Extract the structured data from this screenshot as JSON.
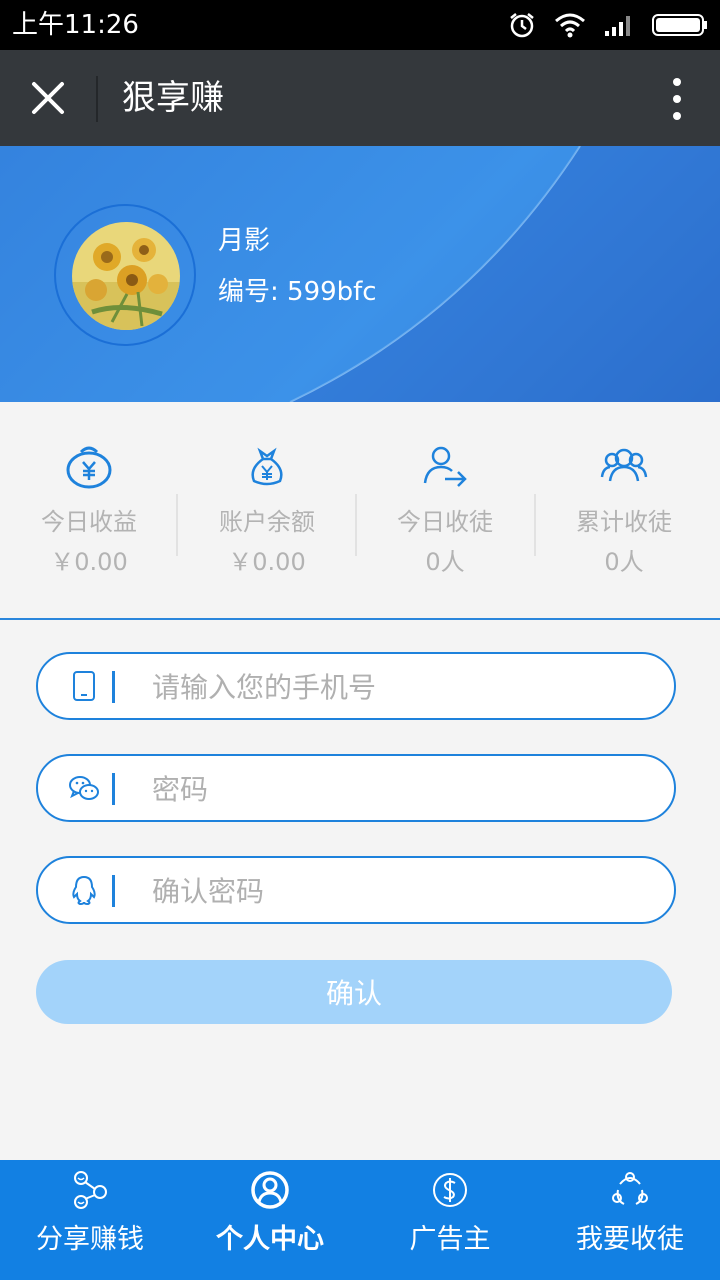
{
  "status_bar": {
    "time": "上午11:26"
  },
  "header": {
    "title": "狠享赚"
  },
  "profile": {
    "name": "月影",
    "id_text": "编号: 599bfc"
  },
  "stats": [
    {
      "icon": "money-bag-yen-icon",
      "label": "今日收益",
      "value": "￥0.00"
    },
    {
      "icon": "money-sack-yen-icon",
      "label": "账户余额",
      "value": "￥0.00"
    },
    {
      "icon": "user-arrow-icon",
      "label": "今日收徒",
      "value": "0人"
    },
    {
      "icon": "users-group-icon",
      "label": "累计收徒",
      "value": "0人"
    }
  ],
  "form": {
    "phone_placeholder": "请输入您的手机号",
    "password_placeholder": "密码",
    "confirm_password_placeholder": "确认密码",
    "confirm_label": "确认"
  },
  "nav": [
    {
      "icon": "share-icon",
      "label": "分享赚钱"
    },
    {
      "icon": "user-circle-icon",
      "label": "个人中心",
      "active": true
    },
    {
      "icon": "dollar-circle-icon",
      "label": "广告主"
    },
    {
      "icon": "network-icon",
      "label": "我要收徒"
    }
  ],
  "colors": {
    "accent": "#1e82dc",
    "nav_bg": "#1280e3",
    "title_bar": "#34383c",
    "confirm_button": "#a3d3fa"
  }
}
